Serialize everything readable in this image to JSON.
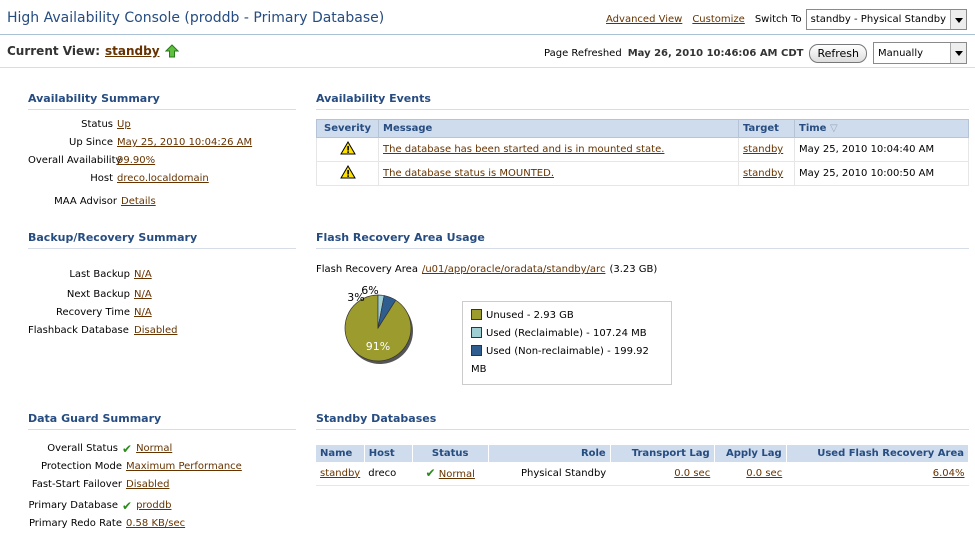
{
  "header": {
    "title": "High Availability Console (proddb - Primary Database)",
    "advanced_view": "Advanced View",
    "customize": "Customize",
    "switch_to_label": "Switch To",
    "switch_to_value": "standby - Physical Standby"
  },
  "current_view": {
    "label": "Current View:",
    "value": "standby",
    "page_refreshed_label": "Page Refreshed",
    "page_refreshed_value": "May 26, 2010 10:46:06 AM CDT",
    "refresh_button": "Refresh",
    "refresh_mode": "Manually"
  },
  "availability_summary": {
    "title": "Availability Summary",
    "rows": [
      {
        "label": "Status",
        "value": "Up"
      },
      {
        "label": "Up Since",
        "value": "May 25, 2010 10:04:26 AM"
      },
      {
        "label": "Overall Availability",
        "value": "99.90%"
      },
      {
        "label": "Host",
        "value": "dreco.localdomain"
      },
      {
        "label": "MAA Advisor",
        "value": "Details"
      }
    ]
  },
  "backup_summary": {
    "title": "Backup/Recovery Summary",
    "rows": [
      {
        "label": "Last Backup",
        "value": "N/A"
      },
      {
        "label": "Next Backup",
        "value": "N/A"
      },
      {
        "label": "Recovery Time",
        "value": "N/A"
      },
      {
        "label": "Flashback Database",
        "value": "Disabled"
      }
    ]
  },
  "dataguard_summary": {
    "title": "Data Guard Summary",
    "rows": [
      {
        "label": "Overall Status",
        "value": "Normal"
      },
      {
        "label": "Protection Mode",
        "value": "Maximum Performance"
      },
      {
        "label": "Fast-Start Failover",
        "value": "Disabled"
      },
      {
        "label": "Primary Database",
        "value": "proddb"
      },
      {
        "label": "Primary Redo Rate",
        "value": "0.58 KB/sec"
      }
    ]
  },
  "availability_events": {
    "title": "Availability Events",
    "columns": [
      "Severity",
      "Message",
      "Target",
      "Time"
    ],
    "rows": [
      {
        "message": "The database has been started and is in mounted state.",
        "target": "standby",
        "time": "May 25, 2010 10:04:40 AM"
      },
      {
        "message": "The database status is MOUNTED.",
        "target": "standby",
        "time": "May 25, 2010 10:00:50 AM"
      }
    ]
  },
  "flash_recovery": {
    "title": "Flash Recovery Area Usage",
    "area_label": "Flash Recovery Area",
    "area_path": "/u01/app/oracle/oradata/standby/arc",
    "area_size": "(3.23 GB)",
    "colors": {
      "unused": "#9b9b2e",
      "reclaimable": "#9fcfd3",
      "nonreclaimable": "#2f5d8f"
    },
    "legend": [
      "Unused - 2.93 GB",
      "Used (Reclaimable) - 107.24 MB",
      "Used (Non-reclaimable) - 199.92 MB"
    ],
    "slice_labels": [
      "91%",
      "3%",
      "6%"
    ],
    "slices": [
      91,
      3,
      6
    ]
  },
  "standby_databases": {
    "title": "Standby Databases",
    "columns": [
      "Name",
      "Host",
      "Status",
      "Role",
      "Transport Lag",
      "Apply Lag",
      "Used Flash Recovery Area"
    ],
    "row": {
      "name": "standby",
      "host": "dreco",
      "status": "Normal",
      "role": "Physical Standby",
      "transport_lag": "0.0 sec",
      "apply_lag": "0.0 sec",
      "used_fra": "6.04%"
    }
  }
}
